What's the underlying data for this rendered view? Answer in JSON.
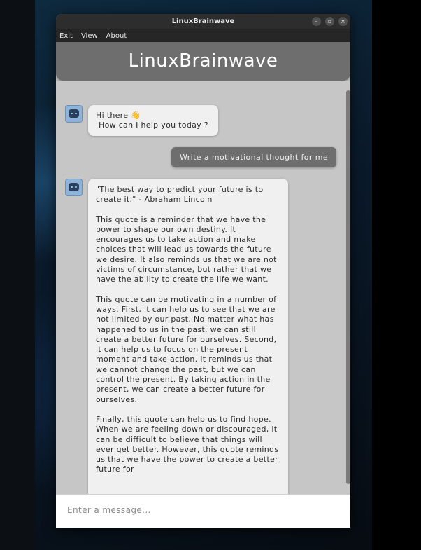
{
  "window": {
    "title": "LinuxBrainwave",
    "controls": {
      "minimize": "–",
      "maximize": "▫",
      "close": "×"
    }
  },
  "menu": [
    "Exit",
    "View",
    "About"
  ],
  "app": {
    "header_title": "LinuxBrainwave"
  },
  "messages": {
    "bot_greeting": {
      "line1": "Hi there 👋",
      "line2": "How can I help you today ?"
    },
    "user_prompt": "Write a motivational thought for me",
    "bot_reply": {
      "p1": "\"The best way to predict your future is to create it.\" - Abraham Lincoln",
      "p2": "This quote is a reminder that we have the power to shape our own destiny. It encourages us to take action and make choices that will lead us towards the future we desire. It also reminds us that we are not victims of circumstance, but rather that we have the ability to create the life we want.",
      "p3": "This quote can be motivating in a number of ways. First, it can help us to see that we are not limited by our past. No matter what has happened to us in the past, we can still create a better future for ourselves. Second, it can help us to focus on the present moment and take action. It reminds us that we cannot change the past, but we can control the present. By taking action in the present, we can create a better future for ourselves.",
      "p4": "Finally, this quote can help us to find hope. When we are feeling down or discouraged, it can be difficult to believe that things will ever get better. However, this quote reminds us that we have the power to create a better future for"
    }
  },
  "input": {
    "placeholder": "Enter a message..."
  },
  "colors": {
    "header": "#6e6e6e",
    "chat_bg": "#c6c6c6",
    "bubble_bot": "#f0f0f0",
    "bubble_user": "#6e6e6e"
  }
}
